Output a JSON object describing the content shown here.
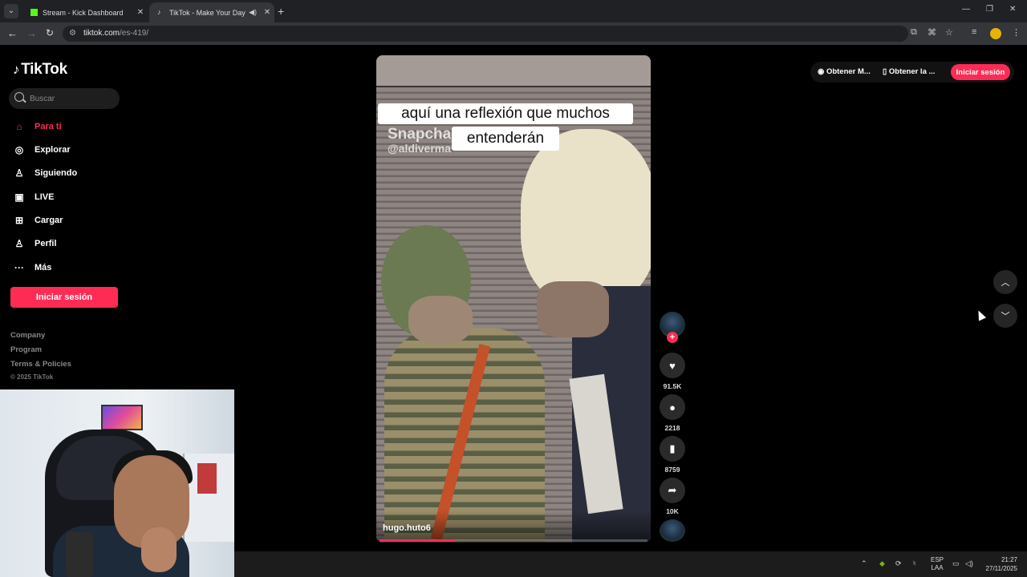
{
  "browser": {
    "tabs": [
      {
        "title": "Stream - Kick Dashboard",
        "favicon_color": "#53fc18"
      },
      {
        "title": "TikTok - Make Your Day",
        "favicon_color": "#ffffff"
      }
    ],
    "url_host": "tiktok.com",
    "url_path": "/es-419/"
  },
  "sidebar": {
    "logo": "TikTok",
    "search_placeholder": "Buscar",
    "items": [
      {
        "label": "Para ti",
        "icon": "home-icon"
      },
      {
        "label": "Explorar",
        "icon": "compass-icon"
      },
      {
        "label": "Siguiendo",
        "icon": "following-icon"
      },
      {
        "label": "LIVE",
        "icon": "live-icon"
      },
      {
        "label": "Cargar",
        "icon": "upload-icon"
      },
      {
        "label": "Perfil",
        "icon": "profile-icon"
      },
      {
        "label": "Más",
        "icon": "more-icon"
      }
    ],
    "login_label": "Iniciar sesión",
    "footer": [
      "Company",
      "Program",
      "Terms & Policies"
    ],
    "copyright": "© 2025 TikTok"
  },
  "video": {
    "caption_line1": "aquí una reflexión que muchos",
    "caption_line2": "entenderán",
    "watermark_app": "Snapcha",
    "watermark_user": "@aldiverma",
    "username": "hugo.huto6",
    "progress_fraction": 0.28
  },
  "actions": {
    "likes": "91.5K",
    "comments": "2218",
    "saves": "8759",
    "shares": "10K"
  },
  "top": {
    "get_coins": "Obtener M...",
    "get_app": "Obtener la ...",
    "login_label": "Iniciar sesión"
  },
  "taskbar": {
    "lang": "ESP",
    "lang_sub": "LAA",
    "time": "21:27",
    "date": "27/11/2025"
  },
  "colors": {
    "accent": "#fe2c55"
  }
}
